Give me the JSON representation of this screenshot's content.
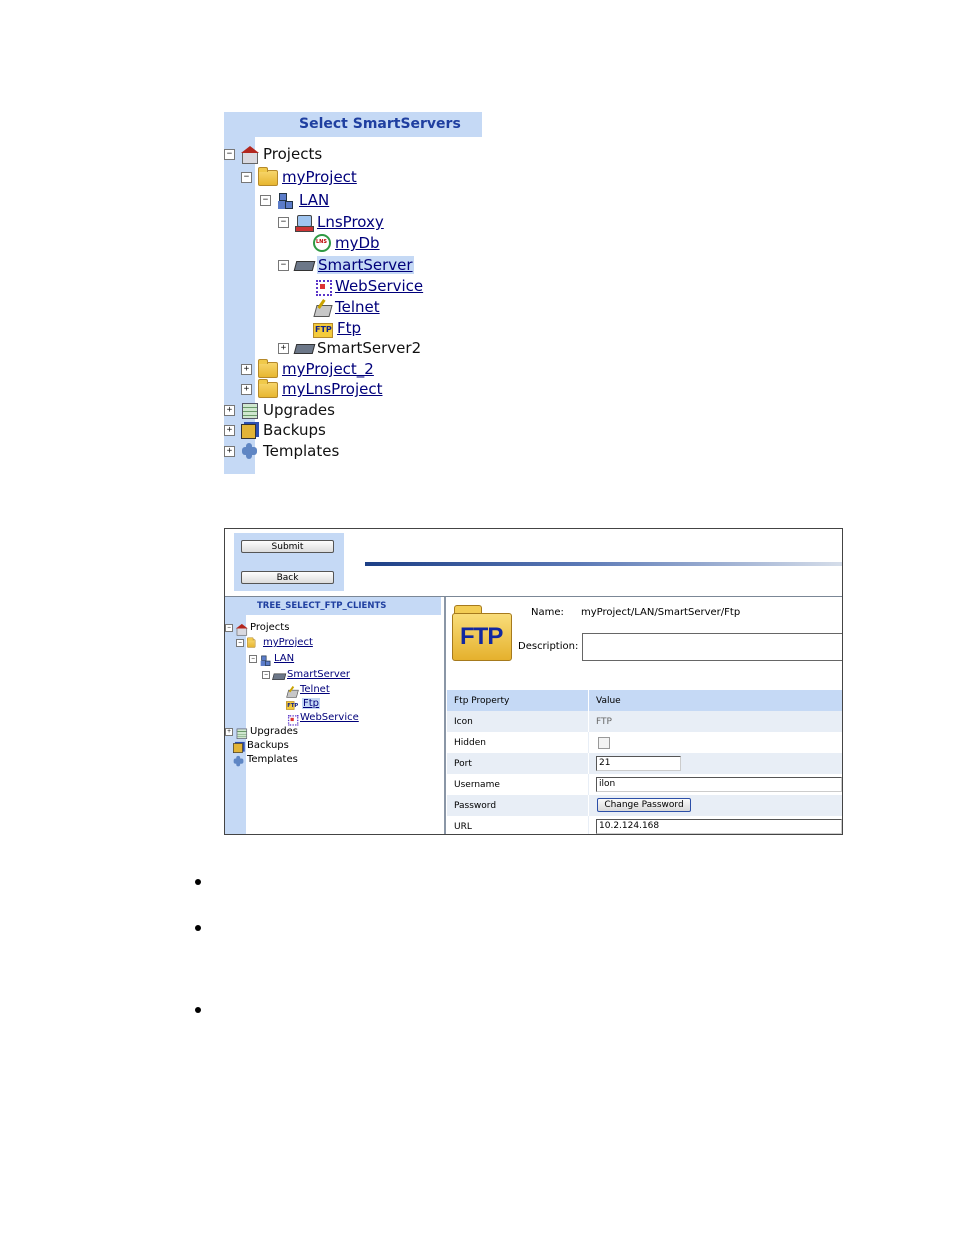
{
  "tree1": {
    "title": "Select SmartServers",
    "rows": [
      {
        "label": "Projects"
      },
      {
        "label": "myProject"
      },
      {
        "label": "LAN"
      },
      {
        "label": "LnsProxy"
      },
      {
        "label": "myDb"
      },
      {
        "label": "SmartServer"
      },
      {
        "label": "WebService"
      },
      {
        "label": "Telnet"
      },
      {
        "label": "Ftp"
      },
      {
        "label": "SmartServer2"
      },
      {
        "label": "myProject_2"
      },
      {
        "label": "myLnsProject"
      },
      {
        "label": "Upgrades"
      },
      {
        "label": "Backups"
      },
      {
        "label": "Templates"
      }
    ],
    "toggles": {
      "minus": "⊟",
      "plus": "⊞"
    }
  },
  "shot2": {
    "submit_label": "Submit",
    "back_label": "Back",
    "tree_title": "TREE_SELECT_FTP_CLIENTS",
    "rows": [
      {
        "label": "Projects"
      },
      {
        "label": "myProject"
      },
      {
        "label": "LAN"
      },
      {
        "label": "SmartServer"
      },
      {
        "label": "Telnet"
      },
      {
        "label": "Ftp"
      },
      {
        "label": "WebService"
      },
      {
        "label": "Upgrades"
      },
      {
        "label": "Backups"
      },
      {
        "label": "Templates"
      }
    ],
    "icon_text": "FTP",
    "name_label": "Name:",
    "name_value": "myProject/LAN/SmartServer/Ftp",
    "description_label": "Description:",
    "description_value": "",
    "grid": {
      "col_property": "Ftp Property",
      "col_value": "Value",
      "rows": [
        {
          "name": "Icon",
          "value": "FTP"
        },
        {
          "name": "Hidden",
          "checked": false
        },
        {
          "name": "Port",
          "value": "21"
        },
        {
          "name": "Username",
          "value": "ilon"
        },
        {
          "name": "Password",
          "button": "Change Password"
        },
        {
          "name": "URL",
          "value": "10.2.124.168"
        }
      ]
    }
  },
  "colors": {
    "accent": "#c5d9f5",
    "link": "#00007a",
    "title": "#1f3fa0"
  }
}
